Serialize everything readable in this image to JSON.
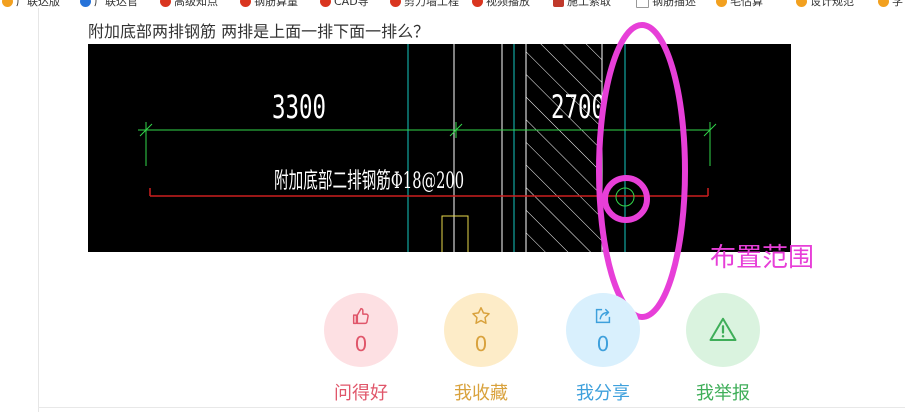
{
  "bookmarks": [
    {
      "label": "广联达版",
      "color": "#f2a01f"
    },
    {
      "label": "广联达官",
      "color": "#2672d9"
    },
    {
      "label": "高级知点",
      "color": "#d9351f"
    },
    {
      "label": "钢筋算量",
      "color": "#d9351f"
    },
    {
      "label": "CAD导",
      "color": "#d9351f"
    },
    {
      "label": "剪力墙工程",
      "color": "#d9351f"
    },
    {
      "label": "视频播放",
      "color": "#d9351f"
    },
    {
      "label": "施工索取",
      "color": "#c0392b"
    },
    {
      "label": "钢筋描述",
      "color": "#999999"
    },
    {
      "label": "毛估算",
      "color": "#f2a01f"
    },
    {
      "label": "设计规范",
      "color": "#f2a01f"
    },
    {
      "label": "学",
      "color": "#f2a01f"
    }
  ],
  "question": {
    "title": "附加底部两排钢筋  两排是上面一排下面一排么？"
  },
  "drawing": {
    "dim_left": "3300",
    "dim_right": "2700",
    "rebar_note": "附加底部二排钢筋Φ18@200"
  },
  "annotation": {
    "label": "布置范围",
    "color": "#e73fd8"
  },
  "actions": [
    {
      "id": "like",
      "count": "0",
      "label": "问得好",
      "bg": "#fde0e3",
      "fg": "#e0566a",
      "icon": "thumbs-up-icon"
    },
    {
      "id": "favorite",
      "count": "0",
      "label": "我收藏",
      "bg": "#fdecc8",
      "fg": "#d9a23d",
      "icon": "star-icon"
    },
    {
      "id": "share",
      "count": "0",
      "label": "我分享",
      "bg": "#d9f0fd",
      "fg": "#3ea0dc",
      "icon": "share-icon"
    },
    {
      "id": "report",
      "count": "",
      "label": "我举报",
      "bg": "#daf3df",
      "fg": "#3fae59",
      "icon": "warning-icon"
    }
  ]
}
